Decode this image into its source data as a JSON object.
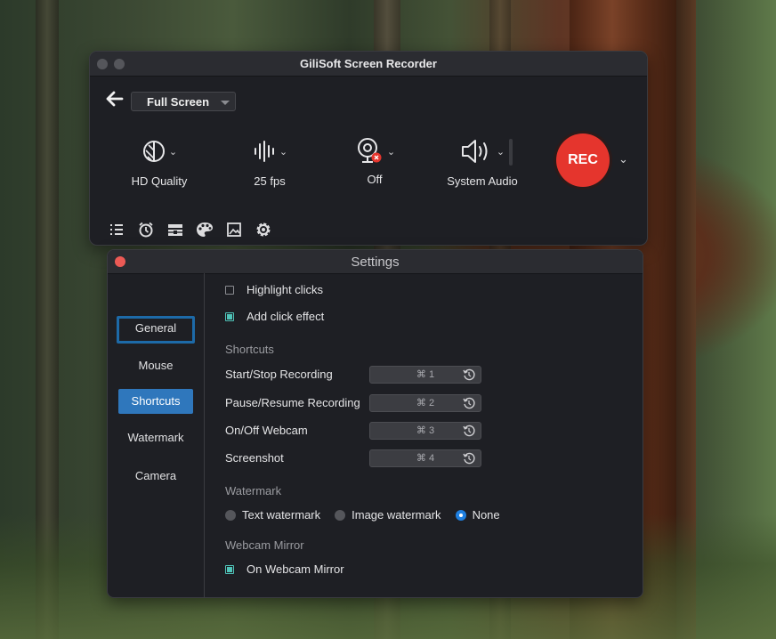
{
  "recorder": {
    "title": "GiliSoft Screen Recorder",
    "mode": "Full Screen",
    "quality": "HD Quality",
    "fps": "25 fps",
    "webcam": "Off",
    "audio": "System Audio",
    "rec_label": "REC",
    "icons": [
      "list-icon",
      "alarm-clock-icon",
      "toolbox-icon",
      "palette-icon",
      "image-icon",
      "gear-icon"
    ]
  },
  "settings": {
    "title": "Settings",
    "sidebar": [
      {
        "label": "General"
      },
      {
        "label": "Mouse"
      },
      {
        "label": "Shortcuts"
      },
      {
        "label": "Watermark"
      },
      {
        "label": "Camera"
      }
    ],
    "mouse": {
      "highlight_clicks": "Highlight clicks",
      "add_click_effect": "Add click effect"
    },
    "shortcuts": {
      "heading": "Shortcuts",
      "items": [
        {
          "label": "Start/Stop Recording",
          "key": "⌘ 1"
        },
        {
          "label": "Pause/Resume Recording",
          "key": "⌘ 2"
        },
        {
          "label": "On/Off Webcam",
          "key": "⌘ 3"
        },
        {
          "label": "Screenshot",
          "key": "⌘ 4"
        }
      ]
    },
    "watermark": {
      "heading": "Watermark",
      "options": [
        "Text watermark",
        "Image watermark",
        "None"
      ],
      "selected": "None"
    },
    "webcam_mirror": {
      "heading": "Webcam Mirror",
      "option": "On Webcam Mirror"
    }
  },
  "colors": {
    "accent": "#2f77bc",
    "rec": "#e5352d",
    "check": "#4fc3b8",
    "radio_selected": "#1e7fe0"
  }
}
